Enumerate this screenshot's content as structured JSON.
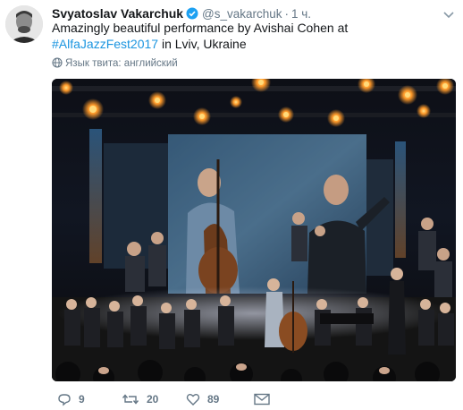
{
  "tweet": {
    "author_name": "Svyatoslav Vakarchuk",
    "handle": "@s_vakarchuk",
    "separator": "·",
    "time": "1 ч.",
    "text_before": "Amazingly beautiful performance by Avishai Cohen at ",
    "hashtag": "#AlfaJazzFest2017",
    "text_after": " in Lviv, Ukraine",
    "language_note": "Язык твита: английский",
    "photo_icon": "concert-photo",
    "actions": {
      "replies": "9",
      "retweets": "20",
      "likes": "89"
    }
  },
  "colors": {
    "accent": "#1b95e0",
    "muted": "#657786",
    "text": "#14171a"
  },
  "icons": [
    "verified-icon",
    "chevron-down-icon",
    "globe-icon",
    "reply-icon",
    "retweet-icon",
    "like-icon",
    "message-icon"
  ]
}
